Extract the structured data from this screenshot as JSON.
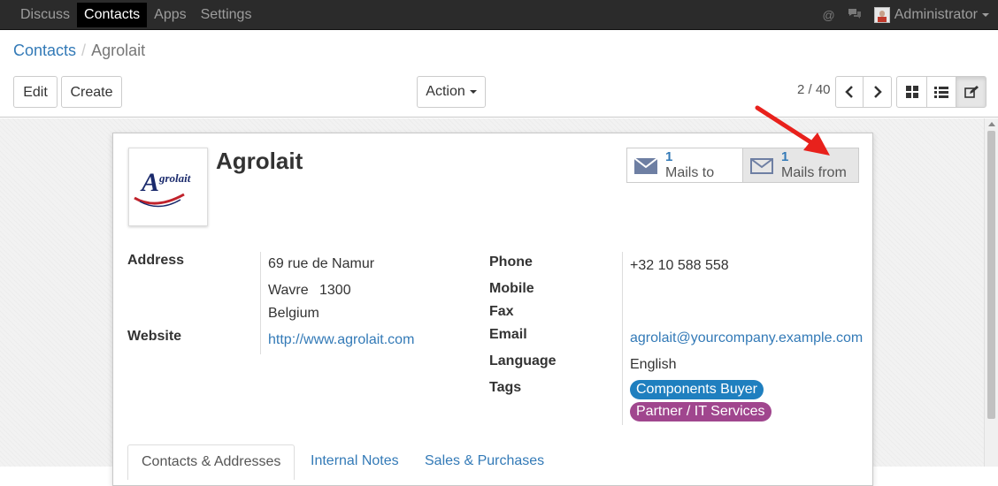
{
  "topbar": {
    "menu": [
      "Discuss",
      "Contacts",
      "Apps",
      "Settings"
    ],
    "active": "Contacts",
    "user": "Administrator"
  },
  "breadcrumb": {
    "parent": "Contacts",
    "separator": "/",
    "current": "Agrolait"
  },
  "buttons": {
    "edit": "Edit",
    "create": "Create",
    "action": "Action"
  },
  "pager": {
    "value": "2 / 40"
  },
  "record": {
    "name": "Agrolait",
    "logo_text": "grolait",
    "mails_to": {
      "count": "1",
      "label": "Mails to"
    },
    "mails_from": {
      "count": "1",
      "label": "Mails from"
    },
    "address_label": "Address",
    "street": "69 rue de Namur",
    "city": "Wavre",
    "zip": "1300",
    "country": "Belgium",
    "website_label": "Website",
    "website": "http://www.agrolait.com",
    "phone_label": "Phone",
    "phone": "+32 10 588 558",
    "mobile_label": "Mobile",
    "fax_label": "Fax",
    "email_label": "Email",
    "email": "agrolait@yourcompany.example.com",
    "language_label": "Language",
    "language": "English",
    "tags_label": "Tags",
    "tags": [
      {
        "label": "Components Buyer",
        "color": "#1f7fbf"
      },
      {
        "label": "Partner / IT Services",
        "color": "#a0468e"
      }
    ]
  },
  "tabs": [
    "Contacts & Addresses",
    "Internal Notes",
    "Sales & Purchases"
  ],
  "colors": {
    "link": "#337ab7",
    "annotation_arrow": "#e8211c"
  }
}
